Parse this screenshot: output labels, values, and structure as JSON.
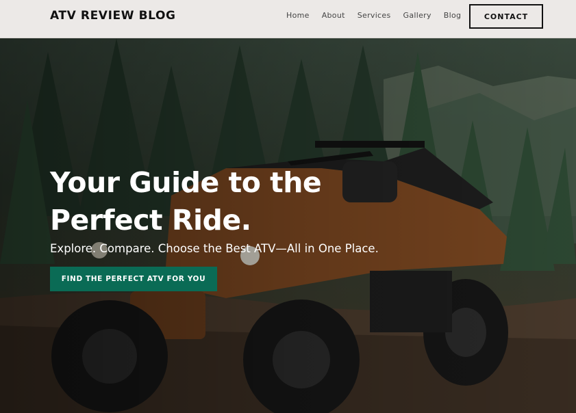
{
  "header": {
    "brand": "ATV REVIEW BLOG",
    "nav": [
      "Home",
      "About",
      "Services",
      "Gallery",
      "Blog"
    ],
    "contact_label": "CONTACT"
  },
  "hero": {
    "headline_line1": "Your Guide to the",
    "headline_line2": "Perfect Ride.",
    "subline": "Explore. Compare. Choose the Best ATV—All in One Place.",
    "cta_label": "FIND THE PERFECT ATV FOR YOU",
    "background_image": "atv-in-forest-photo"
  },
  "colors": {
    "header_bg": "#ece9e7",
    "cta_bg": "#0a6b55",
    "text_dark": "#111111",
    "hero_text": "#ffffff"
  }
}
